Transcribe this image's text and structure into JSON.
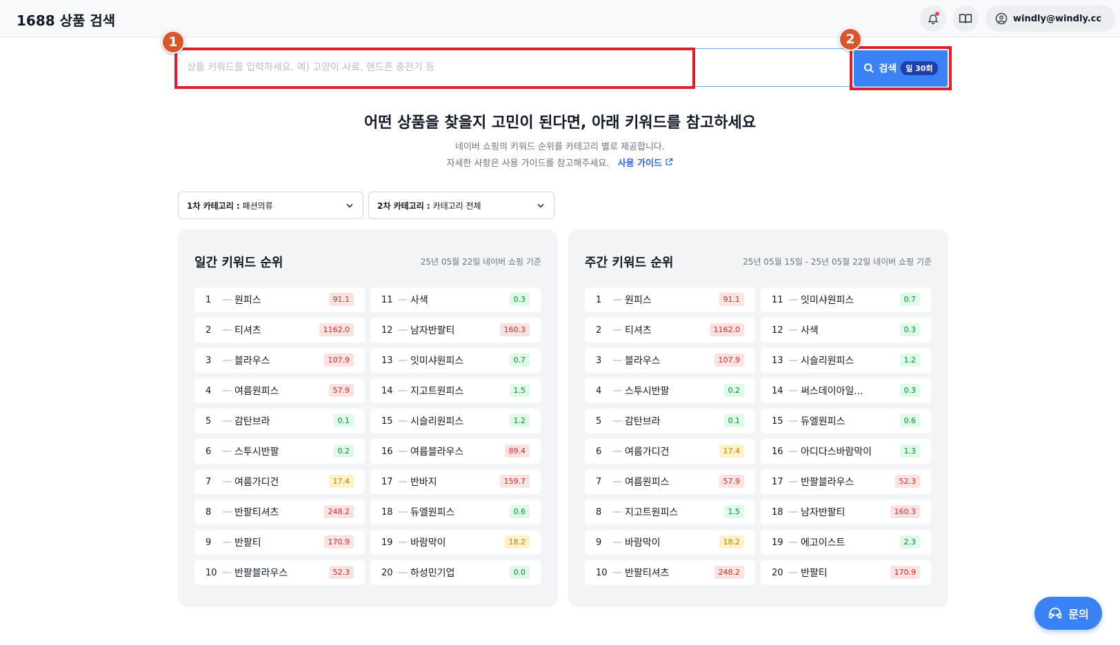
{
  "header": {
    "title": "1688 상품 검색",
    "user_email": "windly@windly.cc"
  },
  "search": {
    "placeholder": "상품 키워드를 입력하세요. 예) 고양이 사료, 핸드폰 충전기 등",
    "button_label": "검색",
    "quota": "일 30회"
  },
  "markers": [
    "1",
    "2"
  ],
  "intro": {
    "headline": "어떤 상품을 찾을지 고민이 된다면, 아래 키워드를 참고하세요",
    "line1": "네이버 쇼핑의 키워드 순위를 카테고리 별로 제공합니다.",
    "line2": "자세한 사항은 사용 가이드를 참고해주세요.",
    "guide_link": "사용 가이드"
  },
  "filters": {
    "cat1_label": "1차 카테고리 :",
    "cat1_value": "패션의류",
    "cat2_label": "2차 카테고리 :",
    "cat2_value": "카테고리 전체"
  },
  "daily": {
    "title": "일간 키워드 순위",
    "date": "25년 05월 22일 네이버 쇼핑 기준",
    "items": [
      {
        "rank": "1",
        "keyword": "원피스",
        "value": "91.1",
        "color": "red"
      },
      {
        "rank": "2",
        "keyword": "티셔츠",
        "value": "1162.0",
        "color": "red"
      },
      {
        "rank": "3",
        "keyword": "블라우스",
        "value": "107.9",
        "color": "red"
      },
      {
        "rank": "4",
        "keyword": "여름원피스",
        "value": "57.9",
        "color": "red"
      },
      {
        "rank": "5",
        "keyword": "감탄브라",
        "value": "0.1",
        "color": "green"
      },
      {
        "rank": "6",
        "keyword": "스투시반팔",
        "value": "0.2",
        "color": "green"
      },
      {
        "rank": "7",
        "keyword": "여름가디건",
        "value": "17.4",
        "color": "yellow"
      },
      {
        "rank": "8",
        "keyword": "반팔티셔츠",
        "value": "248.2",
        "color": "red"
      },
      {
        "rank": "9",
        "keyword": "반팔티",
        "value": "170.9",
        "color": "red"
      },
      {
        "rank": "10",
        "keyword": "반팔블라우스",
        "value": "52.3",
        "color": "red"
      },
      {
        "rank": "11",
        "keyword": "사색",
        "value": "0.3",
        "color": "green"
      },
      {
        "rank": "12",
        "keyword": "남자반팔티",
        "value": "160.3",
        "color": "red"
      },
      {
        "rank": "13",
        "keyword": "잇미샤원피스",
        "value": "0.7",
        "color": "green"
      },
      {
        "rank": "14",
        "keyword": "지고트원피스",
        "value": "1.5",
        "color": "green"
      },
      {
        "rank": "15",
        "keyword": "시슬리원피스",
        "value": "1.2",
        "color": "green"
      },
      {
        "rank": "16",
        "keyword": "여름블라우스",
        "value": "89.4",
        "color": "red"
      },
      {
        "rank": "17",
        "keyword": "반바지",
        "value": "159.7",
        "color": "red"
      },
      {
        "rank": "18",
        "keyword": "듀엘원피스",
        "value": "0.6",
        "color": "green"
      },
      {
        "rank": "19",
        "keyword": "바람막이",
        "value": "18.2",
        "color": "yellow"
      },
      {
        "rank": "20",
        "keyword": "하성민기업",
        "value": "0.0",
        "color": "green"
      }
    ]
  },
  "weekly": {
    "title": "주간 키워드 순위",
    "date": "25년 05월 15일 - 25년 05월 22일 네이버 쇼핑 기준",
    "items": [
      {
        "rank": "1",
        "keyword": "원피스",
        "value": "91.1",
        "color": "red"
      },
      {
        "rank": "2",
        "keyword": "티셔츠",
        "value": "1162.0",
        "color": "red"
      },
      {
        "rank": "3",
        "keyword": "블라우스",
        "value": "107.9",
        "color": "red"
      },
      {
        "rank": "4",
        "keyword": "스투시반팔",
        "value": "0.2",
        "color": "green"
      },
      {
        "rank": "5",
        "keyword": "감탄브라",
        "value": "0.1",
        "color": "green"
      },
      {
        "rank": "6",
        "keyword": "여름가디건",
        "value": "17.4",
        "color": "yellow"
      },
      {
        "rank": "7",
        "keyword": "여름원피스",
        "value": "57.9",
        "color": "red"
      },
      {
        "rank": "8",
        "keyword": "지고트원피스",
        "value": "1.5",
        "color": "green"
      },
      {
        "rank": "9",
        "keyword": "바람막이",
        "value": "18.2",
        "color": "yellow"
      },
      {
        "rank": "10",
        "keyword": "반팔티셔츠",
        "value": "248.2",
        "color": "red"
      },
      {
        "rank": "11",
        "keyword": "잇미샤원피스",
        "value": "0.7",
        "color": "green"
      },
      {
        "rank": "12",
        "keyword": "사색",
        "value": "0.3",
        "color": "green"
      },
      {
        "rank": "13",
        "keyword": "시슬리원피스",
        "value": "1.2",
        "color": "green"
      },
      {
        "rank": "14",
        "keyword": "써스데이아일...",
        "value": "0.3",
        "color": "green"
      },
      {
        "rank": "15",
        "keyword": "듀엘원피스",
        "value": "0.6",
        "color": "green"
      },
      {
        "rank": "16",
        "keyword": "아디다스바람막이",
        "value": "1.3",
        "color": "green"
      },
      {
        "rank": "17",
        "keyword": "반팔블라우스",
        "value": "52.3",
        "color": "red"
      },
      {
        "rank": "18",
        "keyword": "남자반팔티",
        "value": "160.3",
        "color": "red"
      },
      {
        "rank": "19",
        "keyword": "에고이스트",
        "value": "2.3",
        "color": "green"
      },
      {
        "rank": "20",
        "keyword": "반팔티",
        "value": "170.9",
        "color": "red"
      }
    ]
  },
  "contact": {
    "label": "문의"
  },
  "icons": {
    "bell": "bell-icon",
    "book": "book-icon",
    "user": "user-icon",
    "search": "search-icon",
    "chevron": "chevron-down-icon",
    "external": "external-link-icon",
    "headset": "headset-icon"
  },
  "colors": {
    "accent": "#3b82f6",
    "highlight": "#e11d2a",
    "marker": "#d9562b"
  }
}
